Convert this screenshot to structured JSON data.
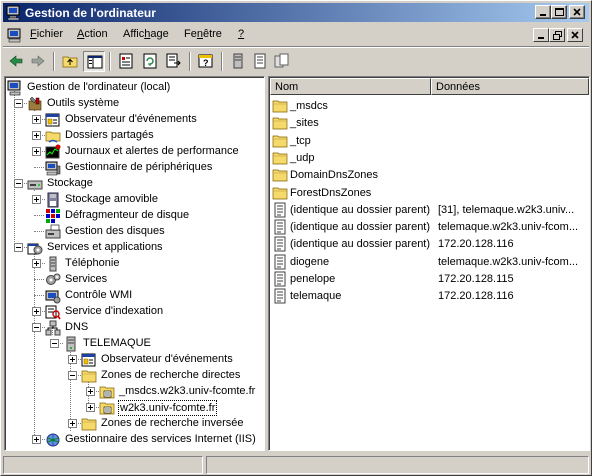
{
  "window": {
    "title": "Gestion de l'ordinateur"
  },
  "menu": {
    "items": [
      {
        "label": "Fichier",
        "accel": "F",
        "rest": "ichier"
      },
      {
        "label": "Action",
        "accel": "A",
        "rest": "ction"
      },
      {
        "label": "Affichage",
        "pre": "Affic",
        "accel": "h",
        "rest": "age"
      },
      {
        "label": "Fenêtre",
        "pre": "Fe",
        "accel": "n",
        "rest": "être"
      },
      {
        "label": "?",
        "accel": "?",
        "rest": ""
      }
    ]
  },
  "tree": {
    "nodes": [
      {
        "label": "Gestion de l'ordinateur (local)",
        "icon": "computer-icon"
      },
      {
        "label": "Outils système",
        "icon": "tools-icon"
      },
      {
        "label": "Observateur d'événements",
        "icon": "event-viewer-icon"
      },
      {
        "label": "Dossiers partagés",
        "icon": "shared-folder-icon"
      },
      {
        "label": "Journaux et alertes de performance",
        "icon": "performance-icon"
      },
      {
        "label": "Gestionnaire de périphériques",
        "icon": "device-manager-icon"
      },
      {
        "label": "Stockage",
        "icon": "storage-icon"
      },
      {
        "label": "Stockage amovible",
        "icon": "removable-storage-icon"
      },
      {
        "label": "Défragmenteur de disque",
        "icon": "defrag-icon"
      },
      {
        "label": "Gestion des disques",
        "icon": "disk-management-icon"
      },
      {
        "label": "Services et applications",
        "icon": "services-apps-icon"
      },
      {
        "label": "Téléphonie",
        "icon": "telephony-icon"
      },
      {
        "label": "Services",
        "icon": "services-icon"
      },
      {
        "label": "Contrôle WMI",
        "icon": "wmi-icon"
      },
      {
        "label": "Service d'indexation",
        "icon": "indexing-icon"
      },
      {
        "label": "DNS",
        "icon": "dns-icon"
      },
      {
        "label": "TELEMAQUE",
        "icon": "server-icon"
      },
      {
        "label": "Observateur d'événements",
        "icon": "event-viewer-icon"
      },
      {
        "label": "Zones de recherche directes",
        "icon": "folder-icon"
      },
      {
        "label": "_msdcs.w2k3.univ-fcomte.fr",
        "icon": "zone-icon"
      },
      {
        "label": "w2k3.univ-fcomte.fr",
        "icon": "zone-icon"
      },
      {
        "label": "Zones de recherche inversée",
        "icon": "folder-icon"
      },
      {
        "label": "Gestionnaire des services Internet (IIS)",
        "icon": "iis-icon"
      }
    ]
  },
  "list": {
    "columns": [
      "Nom",
      "Données"
    ],
    "rows": [
      {
        "name": "_msdcs",
        "data": "",
        "icon": "folder-icon"
      },
      {
        "name": "_sites",
        "data": "",
        "icon": "folder-icon"
      },
      {
        "name": "_tcp",
        "data": "",
        "icon": "folder-icon"
      },
      {
        "name": "_udp",
        "data": "",
        "icon": "folder-icon"
      },
      {
        "name": "DomainDnsZones",
        "data": "",
        "icon": "folder-icon"
      },
      {
        "name": "ForestDnsZones",
        "data": "",
        "icon": "folder-icon"
      },
      {
        "name": "(identique au dossier parent)",
        "data": "[31], telemaque.w2k3.univ...",
        "icon": "record-icon"
      },
      {
        "name": "(identique au dossier parent)",
        "data": "telemaque.w2k3.univ-fcom...",
        "icon": "record-icon"
      },
      {
        "name": "(identique au dossier parent)",
        "data": "172.20.128.116",
        "icon": "record-icon"
      },
      {
        "name": "diogene",
        "data": "telemaque.w2k3.univ-fcom...",
        "icon": "record-icon"
      },
      {
        "name": "penelope",
        "data": "172.20.128.115",
        "icon": "record-icon"
      },
      {
        "name": "telemaque",
        "data": "172.20.128.116",
        "icon": "record-icon"
      }
    ]
  },
  "colors": {
    "title_start": "#0a246a",
    "title_end": "#a6caf0",
    "folder": "#f5d96b"
  }
}
